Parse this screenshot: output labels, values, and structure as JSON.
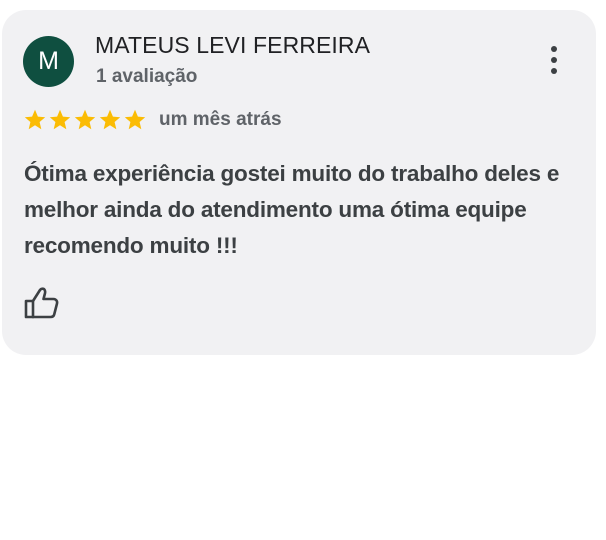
{
  "review": {
    "author": {
      "initial": "M",
      "name": "MATEUS LEVI FERREIRA",
      "review_count": "1 avaliação",
      "avatar_color": "#0f4f40"
    },
    "rating": 5,
    "max_rating": 5,
    "star_color": "#fbbc04",
    "date": "um mês atrás",
    "text": "Ótima experiência gostei muito do trabalho deles e melhor ainda do atendimento uma ótima equipe recomendo muito !!!",
    "actions": {
      "more_icon": "more-vert-icon",
      "like_icon": "thumb-up-icon"
    }
  }
}
